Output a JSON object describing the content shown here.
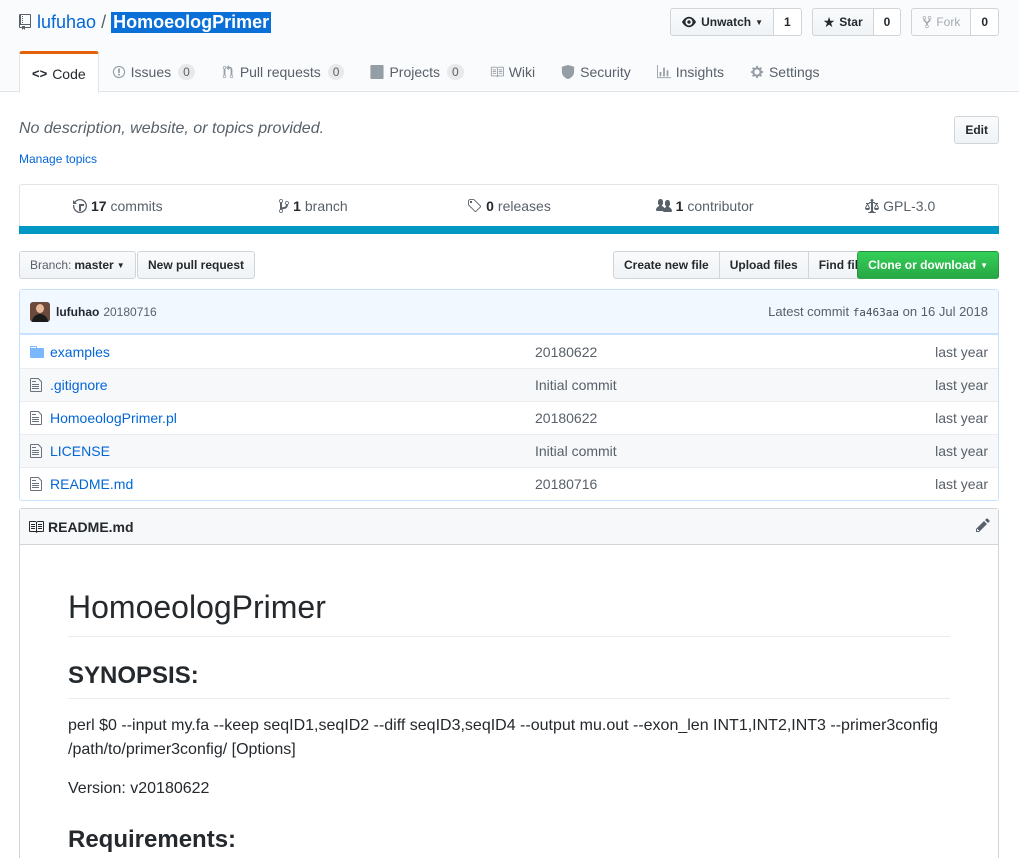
{
  "repo": {
    "owner": "lufuhao",
    "separator": "/",
    "name": "HomoeologPrimer"
  },
  "actions": {
    "watch_label": "Unwatch",
    "watch_count": "1",
    "star_label": "Star",
    "star_count": "0",
    "fork_label": "Fork",
    "fork_count": "0"
  },
  "tabs": [
    {
      "label": "Code",
      "counter": ""
    },
    {
      "label": "Issues",
      "counter": "0"
    },
    {
      "label": "Pull requests",
      "counter": "0"
    },
    {
      "label": "Projects",
      "counter": "0"
    },
    {
      "label": "Wiki",
      "counter": ""
    },
    {
      "label": "Security",
      "counter": ""
    },
    {
      "label": "Insights",
      "counter": ""
    },
    {
      "label": "Settings",
      "counter": ""
    }
  ],
  "description": "No description, website, or topics provided.",
  "manage_topics": "Manage topics",
  "edit_label": "Edit",
  "summary": {
    "commits_count": "17",
    "commits_label": "commits",
    "branch_count": "1",
    "branch_label": "branch",
    "releases_count": "0",
    "releases_label": "releases",
    "contributor_count": "1",
    "contributor_label": "contributor",
    "license": "GPL-3.0"
  },
  "lang_color": "#0298c3",
  "file_nav": {
    "branch_prefix": "Branch:",
    "branch_name": "master",
    "new_pr": "New pull request",
    "create_file": "Create new file",
    "upload_files": "Upload files",
    "find_file": "Find file",
    "clone": "Clone or download"
  },
  "commit": {
    "author": "lufuhao",
    "message": "20180716",
    "latest_label": "Latest commit",
    "sha": "fa463aa",
    "date_prefix": "on",
    "date": "16 Jul 2018"
  },
  "files": [
    {
      "type": "dir",
      "name": "examples",
      "message": "20180622",
      "age": "last year"
    },
    {
      "type": "file",
      "name": ".gitignore",
      "message": "Initial commit",
      "age": "last year"
    },
    {
      "type": "file",
      "name": "HomoeologPrimer.pl",
      "message": "20180622",
      "age": "last year"
    },
    {
      "type": "file",
      "name": "LICENSE",
      "message": "Initial commit",
      "age": "last year"
    },
    {
      "type": "file",
      "name": "README.md",
      "message": "20180716",
      "age": "last year"
    }
  ],
  "readme": {
    "filename": "README.md",
    "title": "HomoeologPrimer",
    "synopsis_heading": "SYNOPSIS:",
    "synopsis_text": "perl $0 --input my.fa --keep seqID1,seqID2 --diff seqID3,seqID4 --output mu.out --exon_len INT1,INT2,INT3 --primer3config /path/to/primer3config/ [Options]",
    "version_text": "Version: v20180622",
    "requirements_heading": "Requirements:"
  }
}
